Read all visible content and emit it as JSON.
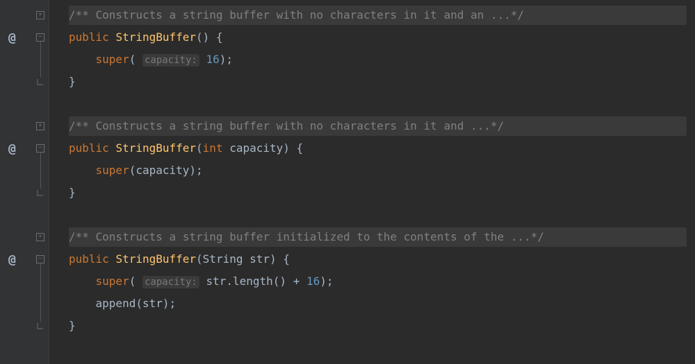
{
  "lineHeight": 32,
  "topOffset": 6,
  "lines": [
    {
      "y": 0,
      "kind": "doc",
      "text": "/** Constructs a string buffer with no characters in it and an ...*/"
    },
    {
      "y": 1,
      "kind": "sig1",
      "kw": "public",
      "name": "StringBuffer",
      "params_open": "() {"
    },
    {
      "y": 2,
      "kind": "super1",
      "indent": "    ",
      "kw": "super",
      "open": "( ",
      "hint": "capacity:",
      "sp": " ",
      "num": "16",
      "close": ");"
    },
    {
      "y": 3,
      "kind": "close",
      "text": "}"
    },
    {
      "y": 4,
      "kind": "blank"
    },
    {
      "y": 5,
      "kind": "doc",
      "text": "/** Constructs a string buffer with no characters in it and ...*/"
    },
    {
      "y": 6,
      "kind": "sig2",
      "kw": "public",
      "name": "StringBuffer",
      "open": "(",
      "ptype": "int",
      "pname": " capacity",
      "close": ") {"
    },
    {
      "y": 7,
      "kind": "super2",
      "indent": "    ",
      "kw": "super",
      "open": "(",
      "arg": "capacity",
      "close": ");"
    },
    {
      "y": 8,
      "kind": "close",
      "text": "}"
    },
    {
      "y": 9,
      "kind": "blank"
    },
    {
      "y": 10,
      "kind": "doc",
      "text": "/** Constructs a string buffer initialized to the contents of the ...*/"
    },
    {
      "y": 11,
      "kind": "sig3",
      "kw": "public",
      "name": "StringBuffer",
      "open": "(",
      "ptype": "String",
      "pname": " str",
      "close": ") {"
    },
    {
      "y": 12,
      "kind": "super3",
      "indent": "    ",
      "kw": "super",
      "open": "( ",
      "hint": "capacity:",
      "sp": " ",
      "expr": "str.length() + ",
      "num": "16",
      "close": ");"
    },
    {
      "y": 13,
      "kind": "append",
      "indent": "    ",
      "call": "append",
      "open": "(",
      "arg": "str",
      "close": ");"
    },
    {
      "y": 14,
      "kind": "close",
      "text": "}"
    }
  ],
  "gutter": {
    "overrideChar": "@",
    "items": [
      {
        "y": 0,
        "fold": "plus"
      },
      {
        "y": 1,
        "override": true,
        "fold": "minus"
      },
      {
        "y": 3,
        "fold": "end"
      },
      {
        "y": 5,
        "fold": "plus"
      },
      {
        "y": 6,
        "override": true,
        "fold": "minus"
      },
      {
        "y": 8,
        "fold": "end"
      },
      {
        "y": 10,
        "fold": "plus"
      },
      {
        "y": 11,
        "override": true,
        "fold": "minus"
      },
      {
        "y": 14,
        "fold": "end"
      }
    ],
    "foldLines": [
      {
        "from": 1,
        "to": 3
      },
      {
        "from": 6,
        "to": 8
      },
      {
        "from": 11,
        "to": 14
      }
    ]
  }
}
